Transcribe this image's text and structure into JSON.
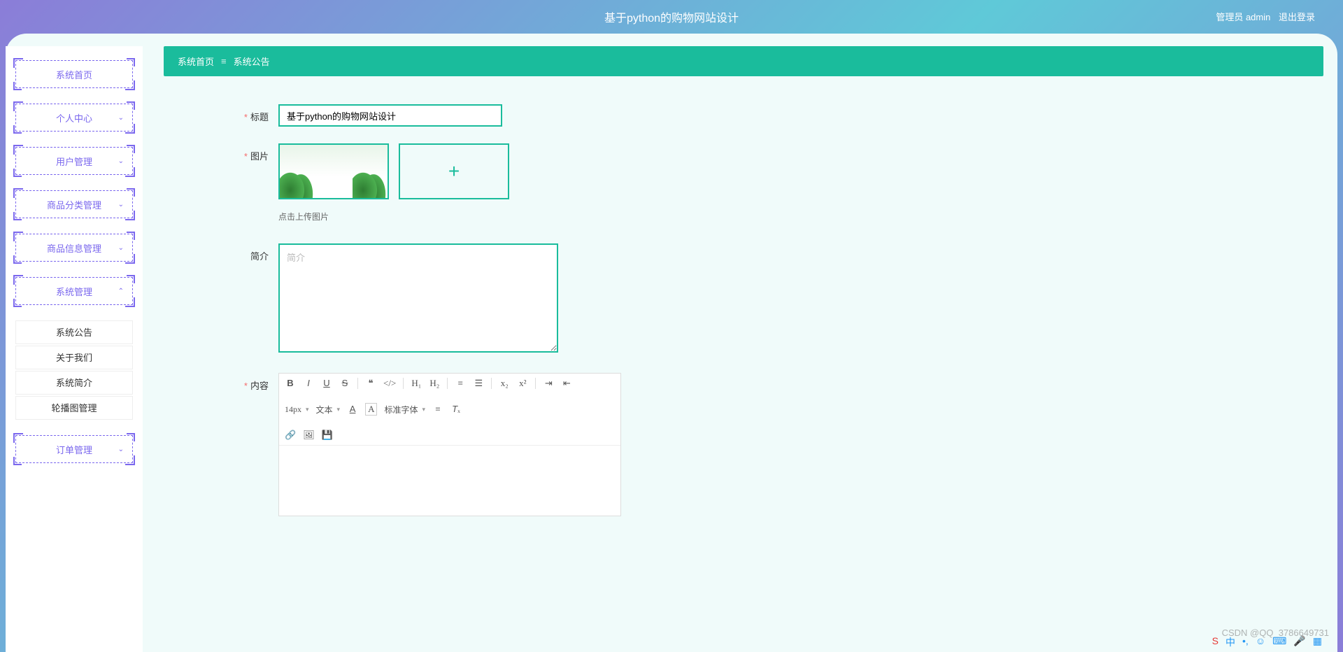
{
  "header": {
    "title": "基于python的购物网站设计",
    "admin_label": "管理员 admin",
    "logout_label": "退出登录"
  },
  "sidebar": {
    "items": [
      {
        "label": "系统首页",
        "expandable": false
      },
      {
        "label": "个人中心",
        "expandable": true
      },
      {
        "label": "用户管理",
        "expandable": true
      },
      {
        "label": "商品分类管理",
        "expandable": true
      },
      {
        "label": "商品信息管理",
        "expandable": true
      },
      {
        "label": "系统管理",
        "expandable": true,
        "expanded": true
      }
    ],
    "sub_items": [
      "系统公告",
      "关于我们",
      "系统简介",
      "轮播图管理"
    ],
    "last_item": {
      "label": "订单管理",
      "expandable": true
    }
  },
  "breadcrumb": {
    "home": "系统首页",
    "sep": "≡",
    "current": "系统公告"
  },
  "form": {
    "title_label": "标题",
    "title_value": "基于python的购物网站设计",
    "image_label": "图片",
    "upload_hint": "点击上传图片",
    "intro_label": "简介",
    "intro_placeholder": "简介",
    "content_label": "内容",
    "editor": {
      "font_size": "14px",
      "text_type": "文本",
      "font_family": "标准字体"
    }
  },
  "watermark": "CSDN @QQ_3786649731"
}
